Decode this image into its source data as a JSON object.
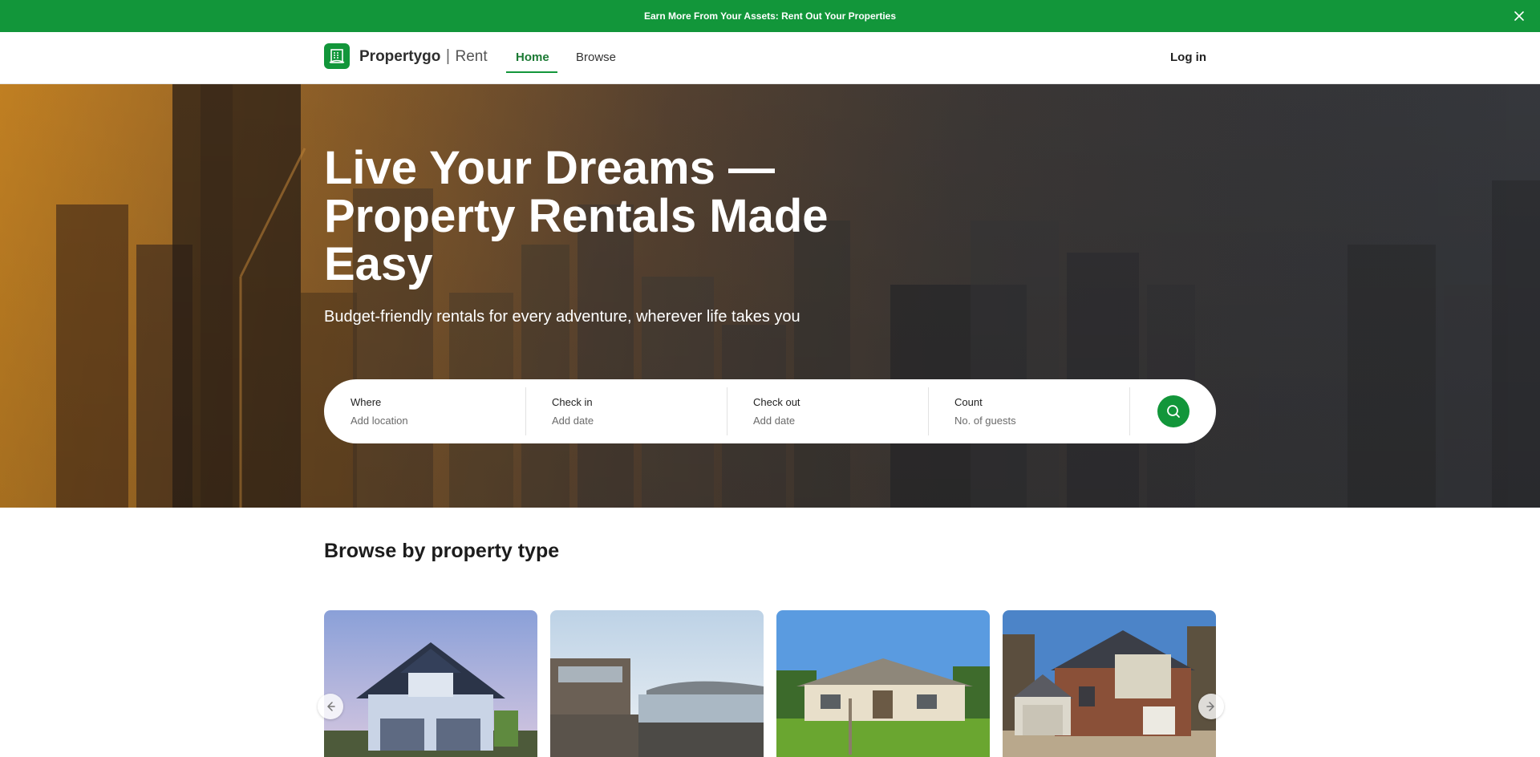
{
  "promo": {
    "text": "Earn More From Your Assets: Rent Out Your Properties"
  },
  "brand": {
    "name": "Propertygo",
    "separator": "|",
    "sub": "Rent",
    "color": "#12963a"
  },
  "nav": {
    "home": "Home",
    "browse": "Browse",
    "login": "Log in",
    "active": "Home"
  },
  "hero": {
    "title": "Live Your Dreams — Property Rentals Made Easy",
    "subtitle": "Budget-friendly rentals for every adventure, wherever life takes you"
  },
  "search": {
    "where": {
      "label": "Where",
      "placeholder": "Add location"
    },
    "checkin": {
      "label": "Check in",
      "placeholder": "Add date"
    },
    "checkout": {
      "label": "Check out",
      "placeholder": "Add date"
    },
    "count": {
      "label": "Count",
      "placeholder": "No. of guests"
    }
  },
  "section": {
    "title": "Browse by property type"
  },
  "cards": [
    {
      "image": "suburban-house-photo"
    },
    {
      "image": "lakeside-house-photo"
    },
    {
      "image": "ranch-house-photo"
    },
    {
      "image": "two-story-house-photo"
    }
  ],
  "icons": {
    "close": "close-icon",
    "search": "search-icon",
    "prev": "chevron-left-icon",
    "next": "chevron-right-icon",
    "logo": "building-logo-icon"
  }
}
